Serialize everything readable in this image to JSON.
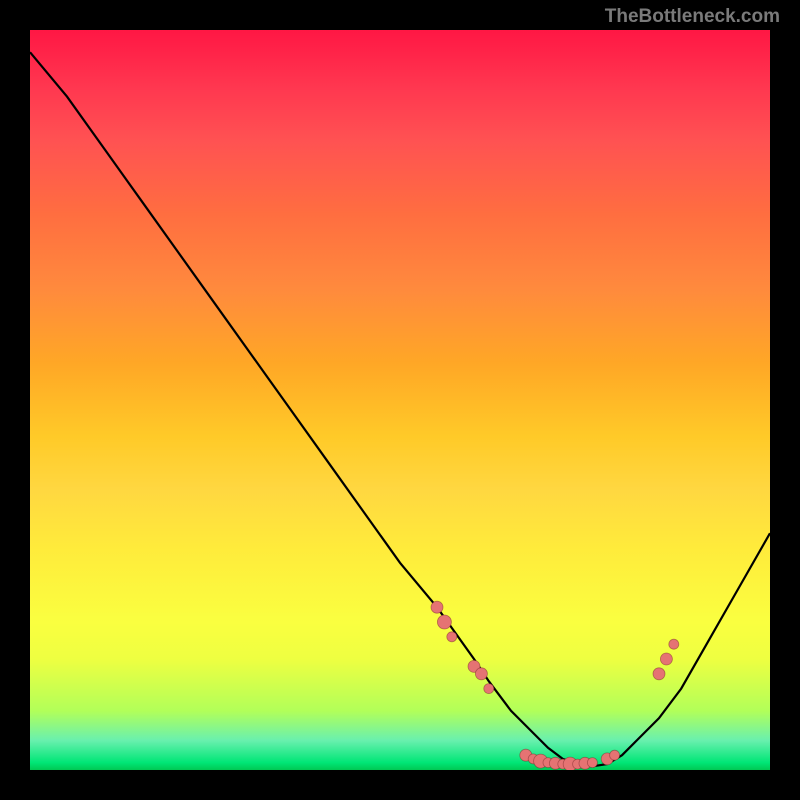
{
  "watermark": "TheBottleneck.com",
  "chart_data": {
    "type": "line",
    "title": "",
    "xlabel": "",
    "ylabel": "",
    "xlim": [
      0,
      100
    ],
    "ylim": [
      0,
      100
    ],
    "series": [
      {
        "name": "bottleneck-curve",
        "x": [
          0,
          5,
          10,
          15,
          20,
          25,
          30,
          35,
          40,
          45,
          50,
          55,
          60,
          62,
          65,
          68,
          70,
          72,
          74,
          76,
          78,
          80,
          82,
          85,
          88,
          92,
          96,
          100
        ],
        "y": [
          97,
          91,
          84,
          77,
          70,
          63,
          56,
          49,
          42,
          35,
          28,
          22,
          15,
          12,
          8,
          5,
          3,
          1.5,
          0.8,
          0.5,
          0.8,
          2,
          4,
          7,
          11,
          18,
          25,
          32
        ]
      }
    ],
    "scatter_points": {
      "name": "highlight-dots",
      "points": [
        {
          "x": 55,
          "y": 22,
          "r": 6
        },
        {
          "x": 56,
          "y": 20,
          "r": 7
        },
        {
          "x": 57,
          "y": 18,
          "r": 5
        },
        {
          "x": 60,
          "y": 14,
          "r": 6
        },
        {
          "x": 61,
          "y": 13,
          "r": 6
        },
        {
          "x": 62,
          "y": 11,
          "r": 5
        },
        {
          "x": 67,
          "y": 2,
          "r": 6
        },
        {
          "x": 68,
          "y": 1.5,
          "r": 5
        },
        {
          "x": 69,
          "y": 1.2,
          "r": 7
        },
        {
          "x": 70,
          "y": 1,
          "r": 5
        },
        {
          "x": 71,
          "y": 0.9,
          "r": 6
        },
        {
          "x": 72,
          "y": 0.8,
          "r": 5
        },
        {
          "x": 73,
          "y": 0.8,
          "r": 7
        },
        {
          "x": 74,
          "y": 0.8,
          "r": 5
        },
        {
          "x": 75,
          "y": 0.9,
          "r": 6
        },
        {
          "x": 76,
          "y": 1,
          "r": 5
        },
        {
          "x": 78,
          "y": 1.5,
          "r": 6
        },
        {
          "x": 79,
          "y": 2,
          "r": 5
        },
        {
          "x": 85,
          "y": 13,
          "r": 6
        },
        {
          "x": 86,
          "y": 15,
          "r": 6
        },
        {
          "x": 87,
          "y": 17,
          "r": 5
        }
      ]
    }
  },
  "colors": {
    "dot_fill": "#e57373",
    "curve_stroke": "#000000",
    "background": "#000000"
  }
}
